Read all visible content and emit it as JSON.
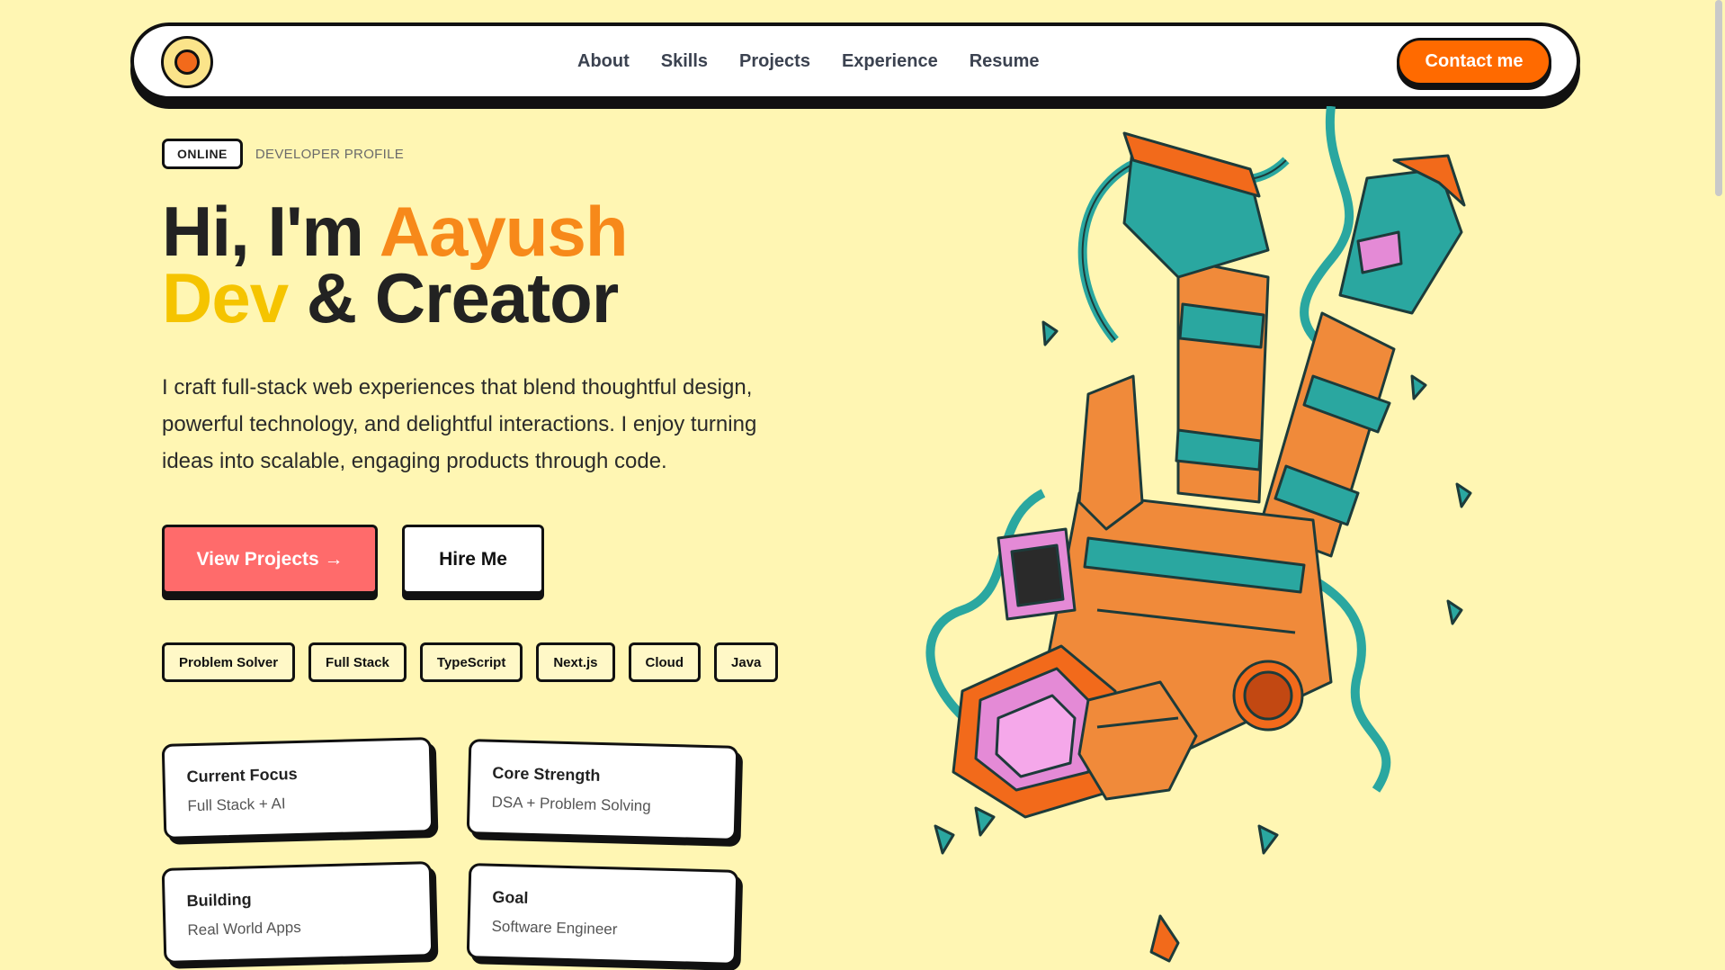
{
  "nav": {
    "links": [
      "About",
      "Skills",
      "Projects",
      "Experience",
      "Resume"
    ],
    "contact_label": "Contact me"
  },
  "hero": {
    "status_badge": "ONLINE",
    "profile_label": "DEVELOPER PROFILE",
    "title_part1": "Hi, I'm ",
    "title_name": "Aayush",
    "title_dev": "Dev",
    "title_part2": " & Creator",
    "description": "I craft full-stack web experiences that blend thoughtful design, powerful technology, and delightful interactions. I enjoy turning ideas into scalable, engaging products through code.",
    "primary_button": "View Projects →",
    "secondary_button": "Hire Me"
  },
  "tags": [
    "Problem Solver",
    "Full Stack",
    "TypeScript",
    "Next.js",
    "Cloud",
    "Java"
  ],
  "cards": [
    {
      "title": "Current Focus",
      "value": "Full Stack + AI"
    },
    {
      "title": "Core Strength",
      "value": "DSA + Problem Solving"
    },
    {
      "title": "Building",
      "value": "Real World Apps"
    },
    {
      "title": "Goal",
      "value": "Software Engineer"
    }
  ],
  "colors": {
    "background": "#fff6b3",
    "accent_orange": "#f7891a",
    "accent_yellow": "#f5c400",
    "contact_button": "#ff6a00",
    "primary_button": "#ff6b6b",
    "astronaut_orange": "#f08a3a",
    "astronaut_teal": "#2aa7a0"
  },
  "illustration": {
    "icon": "astronaut-illustration"
  }
}
